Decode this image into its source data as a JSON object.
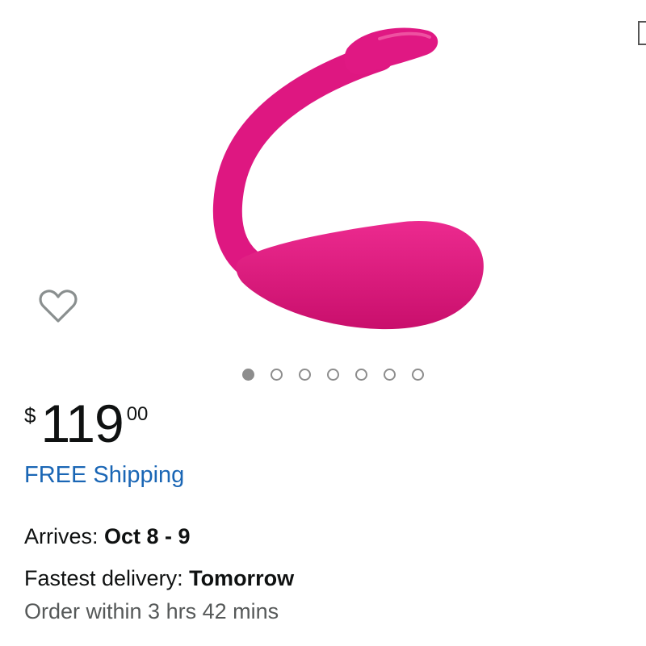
{
  "product": {
    "image_description_icon": "product-image",
    "accent_color": "#e0167f",
    "carousel": {
      "total": 7,
      "active_index": 0
    }
  },
  "wishlist": {
    "icon": "heart-outline-icon"
  },
  "price": {
    "symbol": "$",
    "whole": "119",
    "fraction": "00"
  },
  "shipping": {
    "label": "FREE Shipping",
    "color": "#1a66b5"
  },
  "delivery": {
    "arrives_label": "Arrives: ",
    "arrives_value": "Oct 8 - 9",
    "fastest_label": "Fastest delivery: ",
    "fastest_value": "Tomorrow",
    "order_within": "Order within 3 hrs 42 mins"
  }
}
